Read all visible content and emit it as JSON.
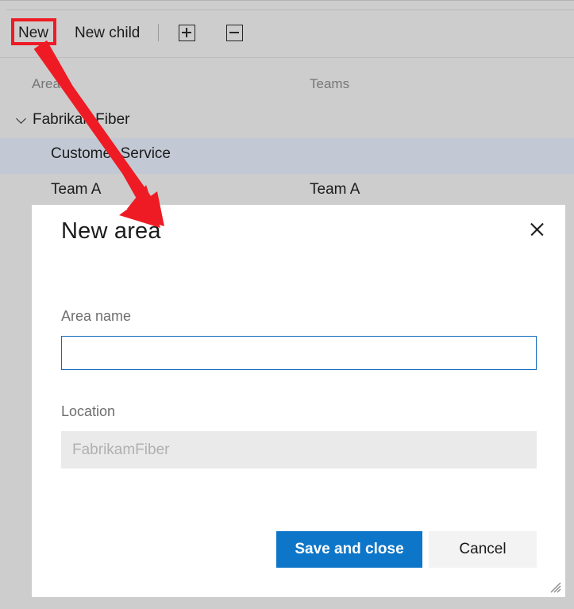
{
  "toolbar": {
    "new_label": "New",
    "new_child_label": "New child",
    "expand_icon": "plus-box-icon",
    "collapse_icon": "minus-box-icon"
  },
  "list": {
    "columns": {
      "area": "Area",
      "teams": "Teams"
    },
    "rows": [
      {
        "name": "FabrikamFiber",
        "team": "",
        "indent": 0,
        "expanded": true,
        "selected": false
      },
      {
        "name": "Customer Service",
        "team": "",
        "indent": 1,
        "expanded": false,
        "selected": true
      },
      {
        "name": "Team A",
        "team": "Team A",
        "indent": 1,
        "expanded": false,
        "selected": false
      }
    ]
  },
  "dialog": {
    "title": "New area",
    "close_icon": "close-icon",
    "area_name": {
      "label": "Area name",
      "value": "",
      "placeholder": ""
    },
    "location": {
      "label": "Location",
      "value": "FabrikamFiber"
    },
    "buttons": {
      "save": "Save and close",
      "cancel": "Cancel"
    },
    "resize_grip_icon": "resize-grip-icon"
  },
  "annotation": {
    "highlight_color": "#ee1b24",
    "arrow_color": "#ee1b24",
    "target": "New"
  },
  "colors": {
    "accent": "#0e76c8",
    "input_border": "#0f6cbd",
    "page_background": "#cdcdcd",
    "row_selected": "#c3c9d4",
    "dialog_background": "#ffffff"
  }
}
